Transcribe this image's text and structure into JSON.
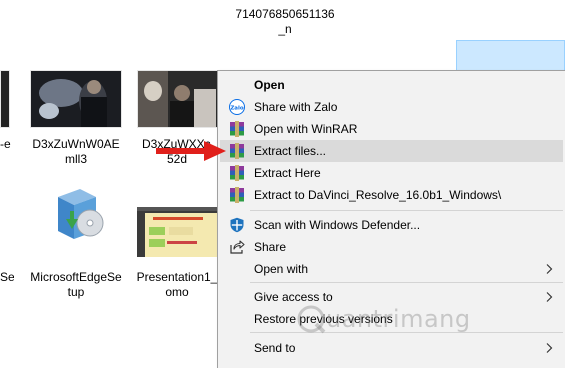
{
  "files": {
    "top_name_line1": "714076850651136",
    "top_name_line2": "_n",
    "file1_line1": "D3xZuWnW0AE",
    "file1_line2": "mll3",
    "file2_line1": "D3xZuWXXc",
    "file2_line2": "52d",
    "left_partial_1": "-e",
    "left_partial_2": "Se",
    "file3_line1": "MicrosoftEdgeSe",
    "file3_line2": "tup",
    "file4_line1": "Presentation1_",
    "file4_line2": "omo"
  },
  "context_menu": {
    "items": [
      {
        "label": "Open",
        "icon": "none",
        "bold": true
      },
      {
        "label": "Share with Zalo",
        "icon": "zalo-icon"
      },
      {
        "label": "Open with WinRAR",
        "icon": "winrar-icon"
      },
      {
        "label": "Extract files...",
        "icon": "winrar-icon",
        "highlighted": true
      },
      {
        "label": "Extract Here",
        "icon": "winrar-icon"
      },
      {
        "label": "Extract to DaVinci_Resolve_16.0b1_Windows\\",
        "icon": "winrar-icon"
      },
      {
        "label": "Scan with Windows Defender...",
        "icon": "windows-defender-icon"
      },
      {
        "label": "Share",
        "icon": "share-icon"
      },
      {
        "label": "Open with",
        "icon": "none",
        "submenu": true
      },
      {
        "label": "Give access to",
        "icon": "none",
        "submenu": true
      },
      {
        "label": "Restore previous versions",
        "icon": "none"
      },
      {
        "label": "Send to",
        "icon": "none",
        "submenu": true
      }
    ]
  },
  "icon_text": {
    "zalo": "Zalo"
  },
  "watermark": "uantrimang",
  "colors": {
    "menu_bg": "#f2f2f2",
    "highlight": "#dadada",
    "selection": "#cce8ff",
    "arrow": "#e0201b",
    "defender_blue": "#1e73be"
  }
}
